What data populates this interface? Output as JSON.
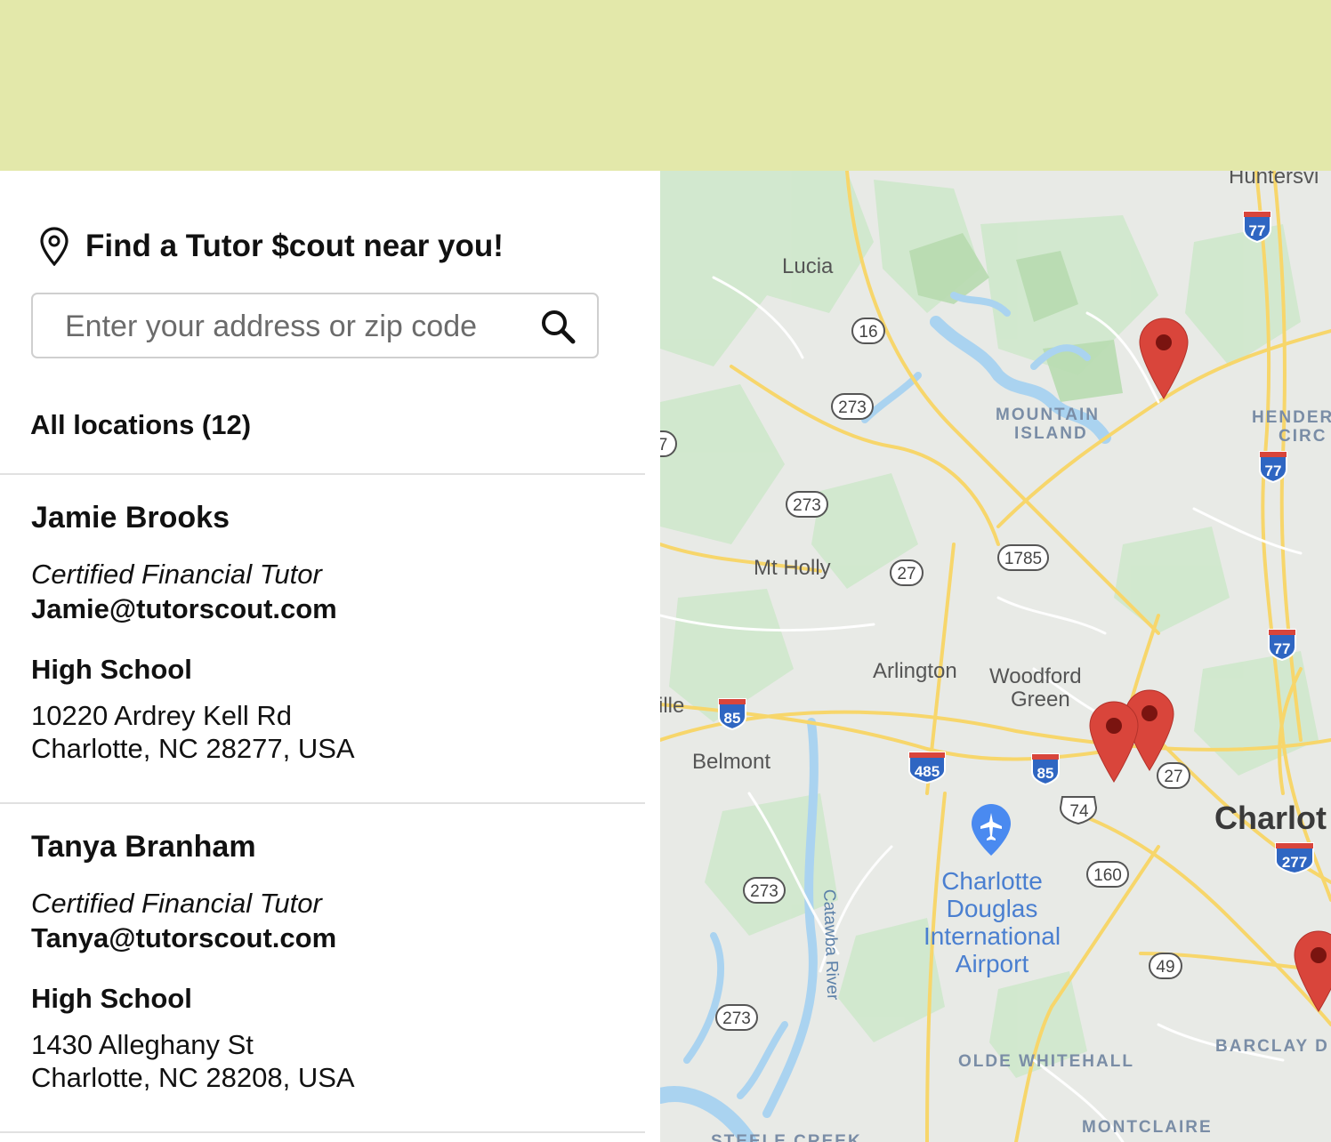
{
  "header": {
    "banner_color": "#e3e8aa"
  },
  "locator": {
    "title": "Find a Tutor $cout near you!",
    "title_icon": "map-pin-icon",
    "search": {
      "placeholder": "Enter your address or zip code",
      "value": "",
      "icon": "search-icon"
    },
    "all_locations_label": "All locations (12)"
  },
  "tutors": [
    {
      "name": "Jamie Brooks",
      "title": "Certified Financial Tutor",
      "email": "Jamie@tutorscout.com",
      "level": "High School",
      "address_line1": "10220 Ardrey Kell Rd",
      "address_line2": "Charlotte, NC 28277, USA"
    },
    {
      "name": "Tanya Branham",
      "title": "Certified Financial Tutor",
      "email": "Tanya@tutorscout.com",
      "level": "High School",
      "address_line1": "1430 Alleghany St",
      "address_line2": "Charlotte, NC 28208, USA"
    }
  ],
  "map": {
    "place_labels": [
      "Huntersvi",
      "Lucia",
      "MOUNTAIN",
      "ISLAND",
      "HENDER",
      "CIRC",
      "Mt Holly",
      "Arlington",
      "Woodford",
      "Green",
      "ille",
      "Belmont",
      "Charlot",
      "Charlotte",
      "Douglas",
      "International",
      "Airport",
      "Catawba River",
      "BARCLAY D",
      "OLDE WHITEHALL",
      "MONTCLAIRE",
      "STEELE CREEK"
    ],
    "route_shields": [
      "16",
      "273",
      "273",
      "273",
      "273",
      "27",
      "1785",
      "27",
      "74",
      "160",
      "49",
      "7"
    ],
    "interstate_shields": [
      "77",
      "77",
      "77",
      "85",
      "485",
      "85",
      "277"
    ],
    "marker_color": "#d9453b",
    "water_color": "#aad3f0",
    "road_color": "#f7d66b"
  }
}
